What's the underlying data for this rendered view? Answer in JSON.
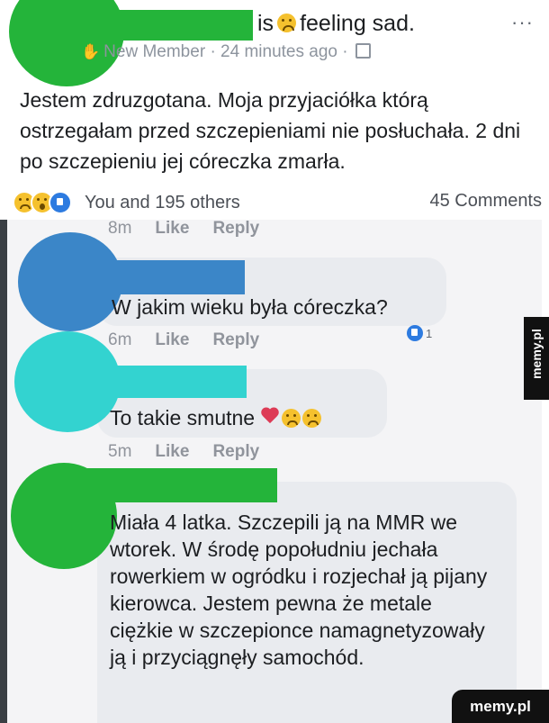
{
  "post": {
    "feeling_prefix": "is",
    "feeling_suffix": "feeling sad.",
    "more_menu": "···",
    "member_label": "New Member",
    "separator": "·",
    "time": "24 minutes ago",
    "text": "Jestem zdruzgotana. Moja przyjaciółka którą ostrzegałam przed szczepieniami nie posłuchała. 2 dni po szczepieniu jej córeczka zmarła.",
    "reactions_summary": "You and 195 others",
    "comments_count": "45 Comments"
  },
  "actions": {
    "like": "Like",
    "reply": "Reply"
  },
  "comments": [
    {
      "time_above": "8m"
    },
    {
      "text": "W jakim wieku była córeczka?",
      "time": "6m",
      "like_count": "1"
    },
    {
      "text": "To takie smutne",
      "time": "5m"
    },
    {
      "text": "Miała 4 latka. Szczepili ją na MMR we wtorek. W środę popołudniu jechała rowerkiem w ogródku i rozjechał ją pijany kierowca. Jestem pewna że metale ciężkie w szczepionce namagnetyzowały ją i przyciągnęły samochód."
    }
  ],
  "watermark": {
    "side": "memy.pl",
    "corner": "memy.pl"
  },
  "colors": {
    "redaction_green": "#24b43a",
    "redaction_blue": "#3b86c8",
    "redaction_cyan": "#33d3d0",
    "bubble": "#e9ebef",
    "like_blue": "#2d7be0"
  }
}
